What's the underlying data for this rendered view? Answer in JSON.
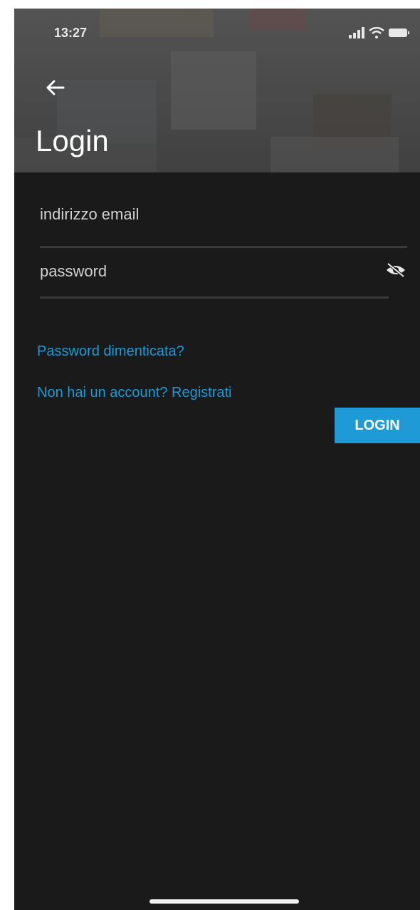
{
  "status_bar": {
    "time": "13:27",
    "icons": [
      "signal-icon",
      "wifi-icon",
      "battery-icon"
    ]
  },
  "header": {
    "back_icon": "arrow-left-icon",
    "title": "Login"
  },
  "form": {
    "email_placeholder": "indirizzo email",
    "email_value": "",
    "password_placeholder": "password",
    "password_value": "",
    "visibility_icon": "eye-off-icon"
  },
  "links": {
    "forgot_password": "Password dimenticata?",
    "register": "Non hai un account? Registrati"
  },
  "login_button_label": "LOGIN",
  "colors": {
    "background": "#1a1a1a",
    "accent": "#1e9ad6",
    "text": "#d8d8d8"
  }
}
